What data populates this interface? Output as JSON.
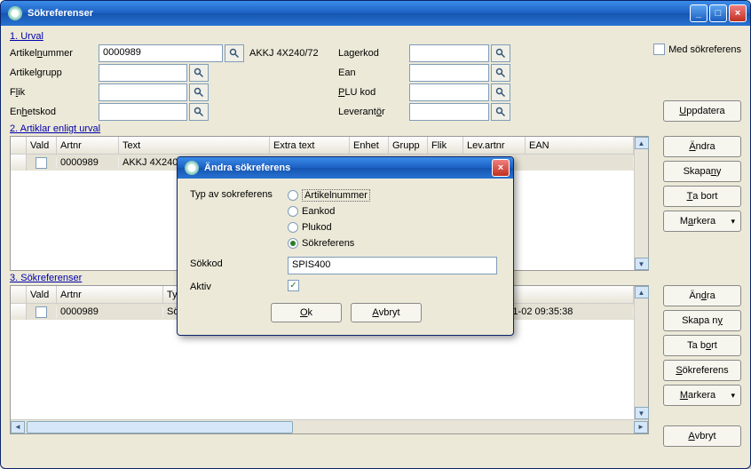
{
  "window": {
    "title": "Sökreferenser"
  },
  "section1": {
    "title": "1. Urval",
    "artikelnummer_label": "Artikelnummer",
    "artikelnummer_value": "0000989",
    "artikelnummer_desc": "AKKJ 4X240/72",
    "artikelgrupp_label": "Artikelgrupp",
    "flik_label": "Flik",
    "enhetskod_label": "Enhetskod",
    "lagerkod_label": "Lagerkod",
    "ean_label": "Ean",
    "plukod_label": "PLU kod",
    "leverantor_label": "Leverantör",
    "medsok_label": "Med sökreferens",
    "uppdatera_btn": "Uppdatera"
  },
  "section2": {
    "title": "2. Artiklar enligt urval",
    "headers": {
      "vald": "Vald",
      "artnr": "Artnr",
      "text": "Text",
      "extratext": "Extra text",
      "enhet": "Enhet",
      "grupp": "Grupp",
      "flik": "Flik",
      "levartnr": "Lev.artnr",
      "ean": "EAN"
    },
    "rows": [
      {
        "artnr": "0000989",
        "text": "AKKJ 4X240/72"
      }
    ],
    "buttons": {
      "andra": "Ändra",
      "skapa": "Skapa ny",
      "tabort": "Ta bort",
      "markera": "Markera"
    }
  },
  "section3": {
    "title": "3. Sökreferenser",
    "headers": {
      "vald": "Vald",
      "artnr": "Artnr",
      "typ": "Typ",
      "sokkod_col": "",
      "skapad": "ad"
    },
    "rows": [
      {
        "artnr": "0000989",
        "typ": "Sökreferens",
        "sokkod": "SPIS400",
        "skapad": "2010-11-02 09:35:38"
      }
    ],
    "buttons": {
      "andra": "Ändra",
      "skapa": "Skapa ny",
      "tabort": "Ta bort",
      "sokref": "Sökreferens",
      "markera": "Markera"
    },
    "avbryt": "Avbryt"
  },
  "modal": {
    "title": "Ändra sökreferens",
    "type_label": "Typ av sokreferens",
    "radios": {
      "artnr": "Artikelnummer",
      "eankod": "Eankod",
      "plukod": "Plukod",
      "sokref": "Sökreferens"
    },
    "sokkod_label": "Sökkod",
    "sokkod_value": "SPIS400",
    "aktiv_label": "Aktiv",
    "ok": "Ok",
    "avbryt": "Avbryt"
  }
}
